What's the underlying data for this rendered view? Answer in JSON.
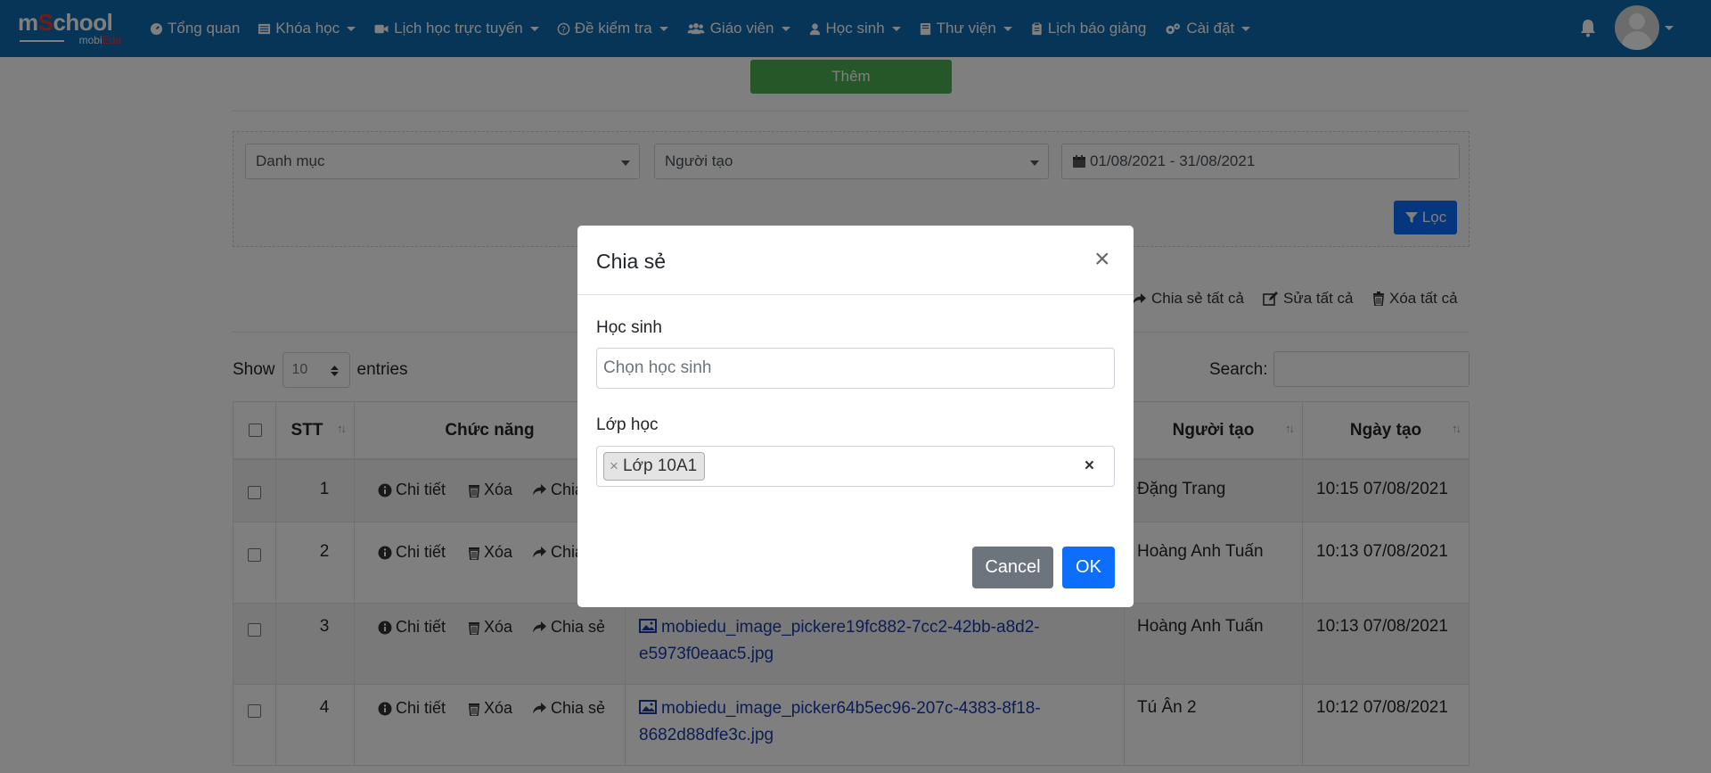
{
  "brand": {
    "logo_top": "mSchool",
    "logo_bottom": "mobiEdu"
  },
  "nav": {
    "items": [
      {
        "label": "Tổng quan",
        "icon": "dashboard-icon",
        "caret": false
      },
      {
        "label": "Khóa học",
        "icon": "list-icon",
        "caret": true
      },
      {
        "label": "Lịch học trực tuyến",
        "icon": "video-icon",
        "caret": true
      },
      {
        "label": "Đề kiểm tra",
        "icon": "question-icon",
        "caret": true
      },
      {
        "label": "Giáo viên",
        "icon": "users-icon",
        "caret": true
      },
      {
        "label": "Học sinh",
        "icon": "user-icon",
        "caret": true
      },
      {
        "label": "Thư viện",
        "icon": "book-icon",
        "caret": true
      },
      {
        "label": "Lịch báo giảng",
        "icon": "clipboard-icon",
        "caret": false
      },
      {
        "label": "Cài đặt",
        "icon": "cogs-icon",
        "caret": true
      }
    ]
  },
  "page": {
    "add_label": "Thêm",
    "filter": {
      "category_placeholder": "Danh mục",
      "creator_placeholder": "Người tạo",
      "date_range": "01/08/2021 - 31/08/2021",
      "filter_label": "Lọc"
    },
    "bulk": {
      "share_all": "Chia sẻ tất cả",
      "edit_all": "Sửa tất cả",
      "delete_all": "Xóa tất cả"
    },
    "length": {
      "show": "Show",
      "value": "10",
      "entries": "entries"
    },
    "search_label": "Search:"
  },
  "table": {
    "headers": {
      "stt": "STT",
      "functions": "Chức năng",
      "creator": "Người tạo",
      "created": "Ngày tạo"
    },
    "actions": {
      "detail": "Chi tiết",
      "delete": "Xóa",
      "share": "Chia sẻ",
      "share_cut": "Chia"
    },
    "rows": [
      {
        "stt": "1",
        "file_line1": "",
        "file_line2": "",
        "creator": "Đặng Trang",
        "created": "10:15 07/08/2021"
      },
      {
        "stt": "2",
        "file_line1": "",
        "file_line2": "",
        "creator": "Hoàng Anh Tuấn",
        "created": "10:13 07/08/2021"
      },
      {
        "stt": "3",
        "file_line1": "mobiedu_image_pickere19fc882-7cc2-42bb-a8d2-",
        "file_line2": "e5973f0eaac5.jpg",
        "creator": "Hoàng Anh Tuấn",
        "created": "10:13 07/08/2021"
      },
      {
        "stt": "4",
        "file_line1": "mobiedu_image_picker64b5ec96-207c-4383-8f18-",
        "file_line2": "8682d88dfe3c.jpg",
        "creator": "Tú Ân 2",
        "created": "10:12 07/08/2021"
      }
    ]
  },
  "modal": {
    "title": "Chia sẻ",
    "close": "×",
    "student_label": "Học sinh",
    "student_placeholder": "Chọn học sinh",
    "class_label": "Lớp học",
    "class_tag": "Lớp 10A1",
    "tag_remove": "×",
    "clear": "×",
    "cancel": "Cancel",
    "ok": "OK"
  },
  "colors": {
    "navbar": "#0f6bb0",
    "add_button": "#4caf50",
    "primary": "#0d6efd",
    "secondary": "#6c757d",
    "link": "#1a3aa8"
  }
}
